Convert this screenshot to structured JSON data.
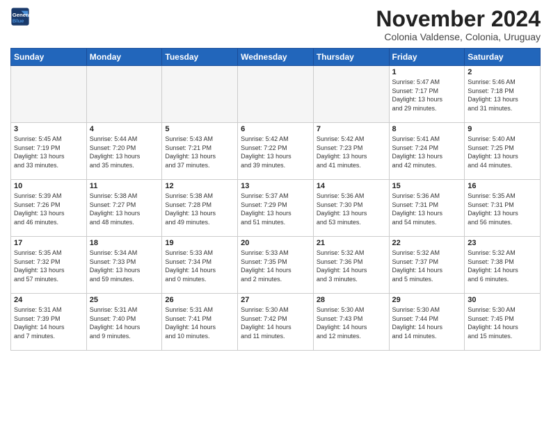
{
  "header": {
    "logo_line1": "General",
    "logo_line2": "Blue",
    "title": "November 2024",
    "subtitle": "Colonia Valdense, Colonia, Uruguay"
  },
  "calendar": {
    "headers": [
      "Sunday",
      "Monday",
      "Tuesday",
      "Wednesday",
      "Thursday",
      "Friday",
      "Saturday"
    ],
    "weeks": [
      [
        {
          "day": "",
          "info": ""
        },
        {
          "day": "",
          "info": ""
        },
        {
          "day": "",
          "info": ""
        },
        {
          "day": "",
          "info": ""
        },
        {
          "day": "",
          "info": ""
        },
        {
          "day": "1",
          "info": "Sunrise: 5:47 AM\nSunset: 7:17 PM\nDaylight: 13 hours\nand 29 minutes."
        },
        {
          "day": "2",
          "info": "Sunrise: 5:46 AM\nSunset: 7:18 PM\nDaylight: 13 hours\nand 31 minutes."
        }
      ],
      [
        {
          "day": "3",
          "info": "Sunrise: 5:45 AM\nSunset: 7:19 PM\nDaylight: 13 hours\nand 33 minutes."
        },
        {
          "day": "4",
          "info": "Sunrise: 5:44 AM\nSunset: 7:20 PM\nDaylight: 13 hours\nand 35 minutes."
        },
        {
          "day": "5",
          "info": "Sunrise: 5:43 AM\nSunset: 7:21 PM\nDaylight: 13 hours\nand 37 minutes."
        },
        {
          "day": "6",
          "info": "Sunrise: 5:42 AM\nSunset: 7:22 PM\nDaylight: 13 hours\nand 39 minutes."
        },
        {
          "day": "7",
          "info": "Sunrise: 5:42 AM\nSunset: 7:23 PM\nDaylight: 13 hours\nand 41 minutes."
        },
        {
          "day": "8",
          "info": "Sunrise: 5:41 AM\nSunset: 7:24 PM\nDaylight: 13 hours\nand 42 minutes."
        },
        {
          "day": "9",
          "info": "Sunrise: 5:40 AM\nSunset: 7:25 PM\nDaylight: 13 hours\nand 44 minutes."
        }
      ],
      [
        {
          "day": "10",
          "info": "Sunrise: 5:39 AM\nSunset: 7:26 PM\nDaylight: 13 hours\nand 46 minutes."
        },
        {
          "day": "11",
          "info": "Sunrise: 5:38 AM\nSunset: 7:27 PM\nDaylight: 13 hours\nand 48 minutes."
        },
        {
          "day": "12",
          "info": "Sunrise: 5:38 AM\nSunset: 7:28 PM\nDaylight: 13 hours\nand 49 minutes."
        },
        {
          "day": "13",
          "info": "Sunrise: 5:37 AM\nSunset: 7:29 PM\nDaylight: 13 hours\nand 51 minutes."
        },
        {
          "day": "14",
          "info": "Sunrise: 5:36 AM\nSunset: 7:30 PM\nDaylight: 13 hours\nand 53 minutes."
        },
        {
          "day": "15",
          "info": "Sunrise: 5:36 AM\nSunset: 7:31 PM\nDaylight: 13 hours\nand 54 minutes."
        },
        {
          "day": "16",
          "info": "Sunrise: 5:35 AM\nSunset: 7:31 PM\nDaylight: 13 hours\nand 56 minutes."
        }
      ],
      [
        {
          "day": "17",
          "info": "Sunrise: 5:35 AM\nSunset: 7:32 PM\nDaylight: 13 hours\nand 57 minutes."
        },
        {
          "day": "18",
          "info": "Sunrise: 5:34 AM\nSunset: 7:33 PM\nDaylight: 13 hours\nand 59 minutes."
        },
        {
          "day": "19",
          "info": "Sunrise: 5:33 AM\nSunset: 7:34 PM\nDaylight: 14 hours\nand 0 minutes."
        },
        {
          "day": "20",
          "info": "Sunrise: 5:33 AM\nSunset: 7:35 PM\nDaylight: 14 hours\nand 2 minutes."
        },
        {
          "day": "21",
          "info": "Sunrise: 5:32 AM\nSunset: 7:36 PM\nDaylight: 14 hours\nand 3 minutes."
        },
        {
          "day": "22",
          "info": "Sunrise: 5:32 AM\nSunset: 7:37 PM\nDaylight: 14 hours\nand 5 minutes."
        },
        {
          "day": "23",
          "info": "Sunrise: 5:32 AM\nSunset: 7:38 PM\nDaylight: 14 hours\nand 6 minutes."
        }
      ],
      [
        {
          "day": "24",
          "info": "Sunrise: 5:31 AM\nSunset: 7:39 PM\nDaylight: 14 hours\nand 7 minutes."
        },
        {
          "day": "25",
          "info": "Sunrise: 5:31 AM\nSunset: 7:40 PM\nDaylight: 14 hours\nand 9 minutes."
        },
        {
          "day": "26",
          "info": "Sunrise: 5:31 AM\nSunset: 7:41 PM\nDaylight: 14 hours\nand 10 minutes."
        },
        {
          "day": "27",
          "info": "Sunrise: 5:30 AM\nSunset: 7:42 PM\nDaylight: 14 hours\nand 11 minutes."
        },
        {
          "day": "28",
          "info": "Sunrise: 5:30 AM\nSunset: 7:43 PM\nDaylight: 14 hours\nand 12 minutes."
        },
        {
          "day": "29",
          "info": "Sunrise: 5:30 AM\nSunset: 7:44 PM\nDaylight: 14 hours\nand 14 minutes."
        },
        {
          "day": "30",
          "info": "Sunrise: 5:30 AM\nSunset: 7:45 PM\nDaylight: 14 hours\nand 15 minutes."
        }
      ]
    ]
  }
}
